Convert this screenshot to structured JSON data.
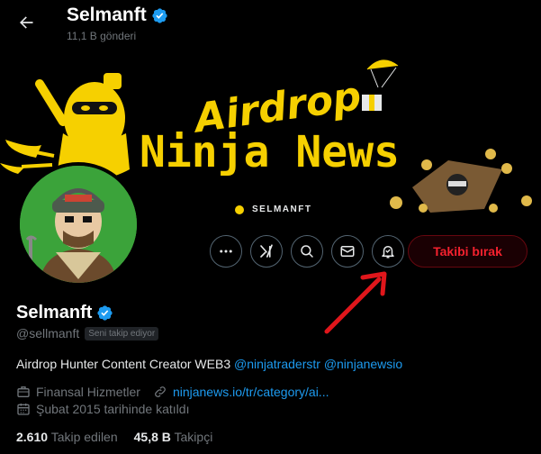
{
  "header": {
    "name": "Selmanft",
    "posts_count": "11,1 B gönderi"
  },
  "banner": {
    "line1": "Airdrop",
    "line2": "Ninja News",
    "handle": "SELMANFT"
  },
  "actions": {
    "unfollow_label": "Takibi bırak"
  },
  "profile": {
    "display_name": "Selmanft",
    "handle": "@sellmanft",
    "follows_you": "Seni takip ediyor",
    "bio_text": "Airdrop Hunter Content Creator WEB3 ",
    "bio_mention_1": "@ninjatraderstr",
    "bio_mention_2": "@ninjanewsio",
    "category": "Finansal Hizmetler",
    "website": "ninjanews.io/tr/category/ai...",
    "joined": "Şubat 2015 tarihinde katıldı",
    "following_count": "2.610",
    "following_label": "Takip edilen",
    "followers_count": "45,8 B",
    "followers_label": "Takipçi"
  },
  "colors": {
    "accent": "#1d9bf0",
    "danger": "#f4212e",
    "banner_yellow": "#f6d000"
  }
}
